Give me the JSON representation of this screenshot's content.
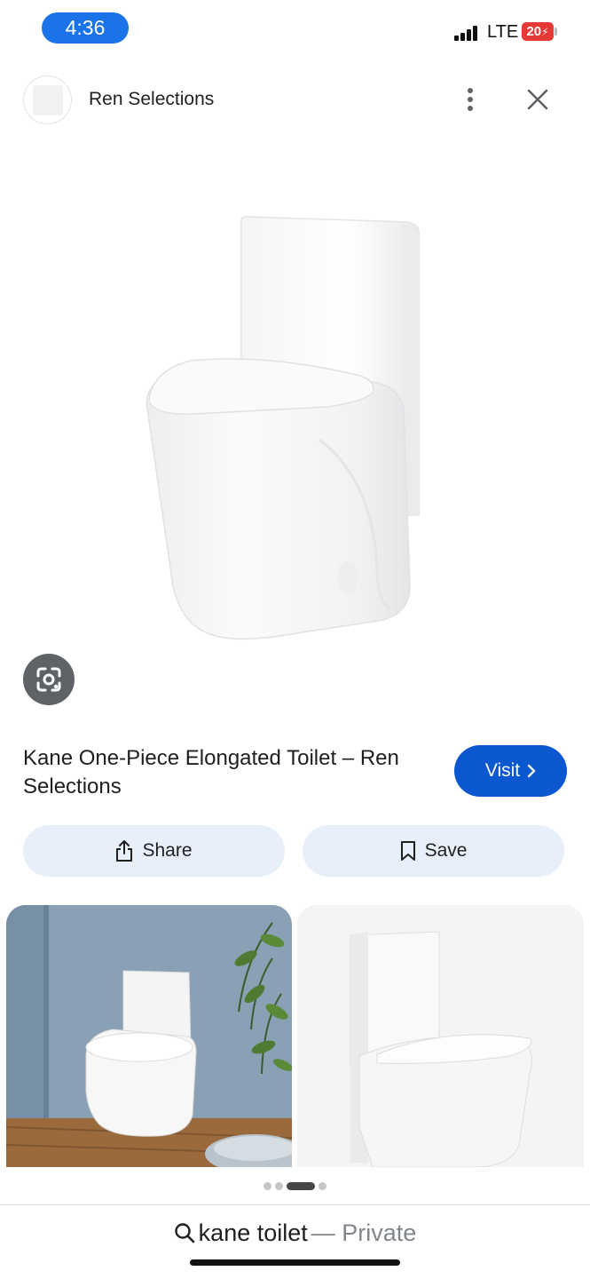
{
  "status_bar": {
    "time": "4:36",
    "network": "LTE",
    "battery": "20",
    "battery_color": "#e53935",
    "time_pill_color": "#1a73e8"
  },
  "header": {
    "site_name": "Ren Selections",
    "more_icon": "more-vert-icon",
    "close_icon": "close-icon"
  },
  "hero": {
    "lens_icon": "google-lens-icon"
  },
  "product": {
    "title": "Kane One-Piece Elongated Toilet – Ren Selections",
    "visit_label": "Visit",
    "visit_color": "#0b57d0"
  },
  "actions": {
    "share_label": "Share",
    "save_label": "Save"
  },
  "carousel": {
    "total": 4,
    "active": 3
  },
  "search": {
    "query": "kane toilet",
    "privacy": "— Private"
  }
}
